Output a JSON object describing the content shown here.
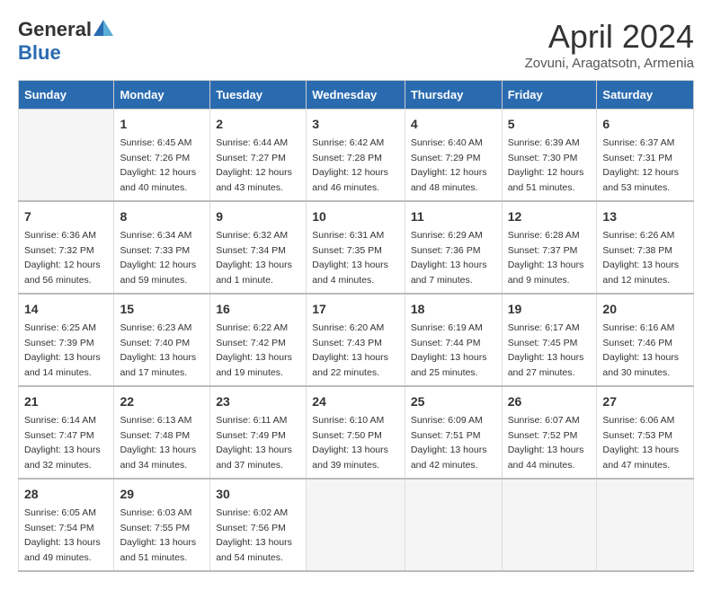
{
  "header": {
    "logo_general": "General",
    "logo_blue": "Blue",
    "month_title": "April 2024",
    "location": "Zovuni, Aragatsotn, Armenia"
  },
  "days_of_week": [
    "Sunday",
    "Monday",
    "Tuesday",
    "Wednesday",
    "Thursday",
    "Friday",
    "Saturday"
  ],
  "weeks": [
    [
      {
        "day": "",
        "sunrise": "",
        "sunset": "",
        "daylight": ""
      },
      {
        "day": "1",
        "sunrise": "Sunrise: 6:45 AM",
        "sunset": "Sunset: 7:26 PM",
        "daylight": "Daylight: 12 hours and 40 minutes."
      },
      {
        "day": "2",
        "sunrise": "Sunrise: 6:44 AM",
        "sunset": "Sunset: 7:27 PM",
        "daylight": "Daylight: 12 hours and 43 minutes."
      },
      {
        "day": "3",
        "sunrise": "Sunrise: 6:42 AM",
        "sunset": "Sunset: 7:28 PM",
        "daylight": "Daylight: 12 hours and 46 minutes."
      },
      {
        "day": "4",
        "sunrise": "Sunrise: 6:40 AM",
        "sunset": "Sunset: 7:29 PM",
        "daylight": "Daylight: 12 hours and 48 minutes."
      },
      {
        "day": "5",
        "sunrise": "Sunrise: 6:39 AM",
        "sunset": "Sunset: 7:30 PM",
        "daylight": "Daylight: 12 hours and 51 minutes."
      },
      {
        "day": "6",
        "sunrise": "Sunrise: 6:37 AM",
        "sunset": "Sunset: 7:31 PM",
        "daylight": "Daylight: 12 hours and 53 minutes."
      }
    ],
    [
      {
        "day": "7",
        "sunrise": "Sunrise: 6:36 AM",
        "sunset": "Sunset: 7:32 PM",
        "daylight": "Daylight: 12 hours and 56 minutes."
      },
      {
        "day": "8",
        "sunrise": "Sunrise: 6:34 AM",
        "sunset": "Sunset: 7:33 PM",
        "daylight": "Daylight: 12 hours and 59 minutes."
      },
      {
        "day": "9",
        "sunrise": "Sunrise: 6:32 AM",
        "sunset": "Sunset: 7:34 PM",
        "daylight": "Daylight: 13 hours and 1 minute."
      },
      {
        "day": "10",
        "sunrise": "Sunrise: 6:31 AM",
        "sunset": "Sunset: 7:35 PM",
        "daylight": "Daylight: 13 hours and 4 minutes."
      },
      {
        "day": "11",
        "sunrise": "Sunrise: 6:29 AM",
        "sunset": "Sunset: 7:36 PM",
        "daylight": "Daylight: 13 hours and 7 minutes."
      },
      {
        "day": "12",
        "sunrise": "Sunrise: 6:28 AM",
        "sunset": "Sunset: 7:37 PM",
        "daylight": "Daylight: 13 hours and 9 minutes."
      },
      {
        "day": "13",
        "sunrise": "Sunrise: 6:26 AM",
        "sunset": "Sunset: 7:38 PM",
        "daylight": "Daylight: 13 hours and 12 minutes."
      }
    ],
    [
      {
        "day": "14",
        "sunrise": "Sunrise: 6:25 AM",
        "sunset": "Sunset: 7:39 PM",
        "daylight": "Daylight: 13 hours and 14 minutes."
      },
      {
        "day": "15",
        "sunrise": "Sunrise: 6:23 AM",
        "sunset": "Sunset: 7:40 PM",
        "daylight": "Daylight: 13 hours and 17 minutes."
      },
      {
        "day": "16",
        "sunrise": "Sunrise: 6:22 AM",
        "sunset": "Sunset: 7:42 PM",
        "daylight": "Daylight: 13 hours and 19 minutes."
      },
      {
        "day": "17",
        "sunrise": "Sunrise: 6:20 AM",
        "sunset": "Sunset: 7:43 PM",
        "daylight": "Daylight: 13 hours and 22 minutes."
      },
      {
        "day": "18",
        "sunrise": "Sunrise: 6:19 AM",
        "sunset": "Sunset: 7:44 PM",
        "daylight": "Daylight: 13 hours and 25 minutes."
      },
      {
        "day": "19",
        "sunrise": "Sunrise: 6:17 AM",
        "sunset": "Sunset: 7:45 PM",
        "daylight": "Daylight: 13 hours and 27 minutes."
      },
      {
        "day": "20",
        "sunrise": "Sunrise: 6:16 AM",
        "sunset": "Sunset: 7:46 PM",
        "daylight": "Daylight: 13 hours and 30 minutes."
      }
    ],
    [
      {
        "day": "21",
        "sunrise": "Sunrise: 6:14 AM",
        "sunset": "Sunset: 7:47 PM",
        "daylight": "Daylight: 13 hours and 32 minutes."
      },
      {
        "day": "22",
        "sunrise": "Sunrise: 6:13 AM",
        "sunset": "Sunset: 7:48 PM",
        "daylight": "Daylight: 13 hours and 34 minutes."
      },
      {
        "day": "23",
        "sunrise": "Sunrise: 6:11 AM",
        "sunset": "Sunset: 7:49 PM",
        "daylight": "Daylight: 13 hours and 37 minutes."
      },
      {
        "day": "24",
        "sunrise": "Sunrise: 6:10 AM",
        "sunset": "Sunset: 7:50 PM",
        "daylight": "Daylight: 13 hours and 39 minutes."
      },
      {
        "day": "25",
        "sunrise": "Sunrise: 6:09 AM",
        "sunset": "Sunset: 7:51 PM",
        "daylight": "Daylight: 13 hours and 42 minutes."
      },
      {
        "day": "26",
        "sunrise": "Sunrise: 6:07 AM",
        "sunset": "Sunset: 7:52 PM",
        "daylight": "Daylight: 13 hours and 44 minutes."
      },
      {
        "day": "27",
        "sunrise": "Sunrise: 6:06 AM",
        "sunset": "Sunset: 7:53 PM",
        "daylight": "Daylight: 13 hours and 47 minutes."
      }
    ],
    [
      {
        "day": "28",
        "sunrise": "Sunrise: 6:05 AM",
        "sunset": "Sunset: 7:54 PM",
        "daylight": "Daylight: 13 hours and 49 minutes."
      },
      {
        "day": "29",
        "sunrise": "Sunrise: 6:03 AM",
        "sunset": "Sunset: 7:55 PM",
        "daylight": "Daylight: 13 hours and 51 minutes."
      },
      {
        "day": "30",
        "sunrise": "Sunrise: 6:02 AM",
        "sunset": "Sunset: 7:56 PM",
        "daylight": "Daylight: 13 hours and 54 minutes."
      },
      {
        "day": "",
        "sunrise": "",
        "sunset": "",
        "daylight": ""
      },
      {
        "day": "",
        "sunrise": "",
        "sunset": "",
        "daylight": ""
      },
      {
        "day": "",
        "sunrise": "",
        "sunset": "",
        "daylight": ""
      },
      {
        "day": "",
        "sunrise": "",
        "sunset": "",
        "daylight": ""
      }
    ]
  ]
}
